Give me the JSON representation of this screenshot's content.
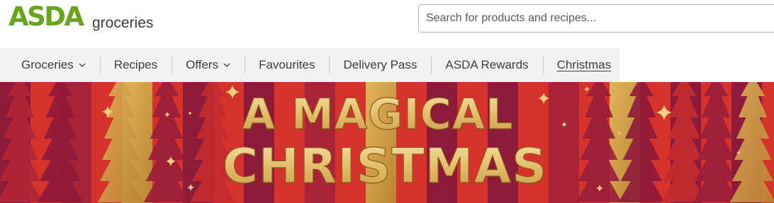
{
  "header": {
    "logo_text": "ASDA",
    "logo_sub": "groceries",
    "search_placeholder": "Search for products and recipes..."
  },
  "nav": {
    "items": [
      {
        "label": "Groceries",
        "has_dropdown": true
      },
      {
        "label": "Recipes",
        "has_dropdown": false
      },
      {
        "label": "Offers",
        "has_dropdown": true
      },
      {
        "label": "Favourites",
        "has_dropdown": false
      },
      {
        "label": "Delivery Pass",
        "has_dropdown": false
      },
      {
        "label": "ASDA Rewards",
        "has_dropdown": false
      },
      {
        "label": "Christmas",
        "has_dropdown": false,
        "active": true
      }
    ]
  },
  "banner": {
    "line1": "A MAGICAL",
    "line2": "CHRISTMAS"
  },
  "colors": {
    "brand_green": "#68a51c",
    "banner_red": "#d6322c",
    "banner_maroon": "#8e1a3a",
    "banner_gold": "#d4a64a"
  }
}
